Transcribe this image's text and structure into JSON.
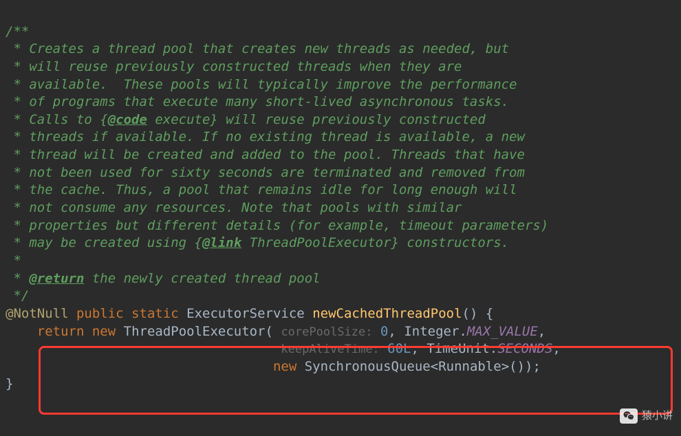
{
  "colors": {
    "background": "#2b2b2b",
    "comment": "#5f9e5f",
    "keyword": "#cc7832",
    "annotation": "#b0a36e",
    "method": "#ffc66d",
    "hint": "#6a6a6a",
    "number": "#6897bb",
    "static_field": "#9876aa",
    "highlight_border": "#ff3b30"
  },
  "javadoc": {
    "open": "/**",
    "lines": [
      " * Creates a thread pool that creates new threads as needed, but",
      " * will reuse previously constructed threads when they are",
      " * available.  These pools will typically improve the performance",
      " * of programs that execute many short-lived asynchronous tasks.",
      " * Calls to {",
      " execute} will reuse previously constructed",
      " * threads if available. If no existing thread is available, a new",
      " * thread will be created and added to the pool. Threads that have",
      " * not been used for sixty seconds are terminated and removed from",
      " * the cache. Thus, a pool that remains idle for long enough will",
      " * not consume any resources. Note that pools with similar",
      " * properties but different details (for example, timeout parameters)",
      " * may be created using {",
      " ThreadPoolExecutor} constructors.",
      " *",
      " * ",
      " the newly created thread pool"
    ],
    "tag_code": "@code",
    "tag_link": "@link",
    "tag_return": "@return",
    "close": " */"
  },
  "signature": {
    "annotation": "@NotNull",
    "modifiers_public": "public",
    "modifiers_static": "static",
    "return_type": "ExecutorService",
    "method_name": "newCachedThreadPool",
    "parens_open": "()",
    "brace_open": " {"
  },
  "body": {
    "return_kw": "return",
    "new_kw": "new",
    "ctor": "ThreadPoolExecutor",
    "hint_core": "corePoolSize:",
    "arg_core": "0",
    "comma": ",",
    "integer_class": "Integer",
    "dot": ".",
    "max_value": "MAX_VALUE",
    "hint_keep": "keepAliveTime:",
    "arg_keep": "60L",
    "timeunit_class": "TimeUnit",
    "seconds": "SECONDS",
    "sync_queue": "SynchronousQueue",
    "lt": "<",
    "runnable": "Runnable",
    "gt": ">",
    "tail": "());"
  },
  "close_brace": "}",
  "watermark": {
    "text": "猿小讲"
  }
}
